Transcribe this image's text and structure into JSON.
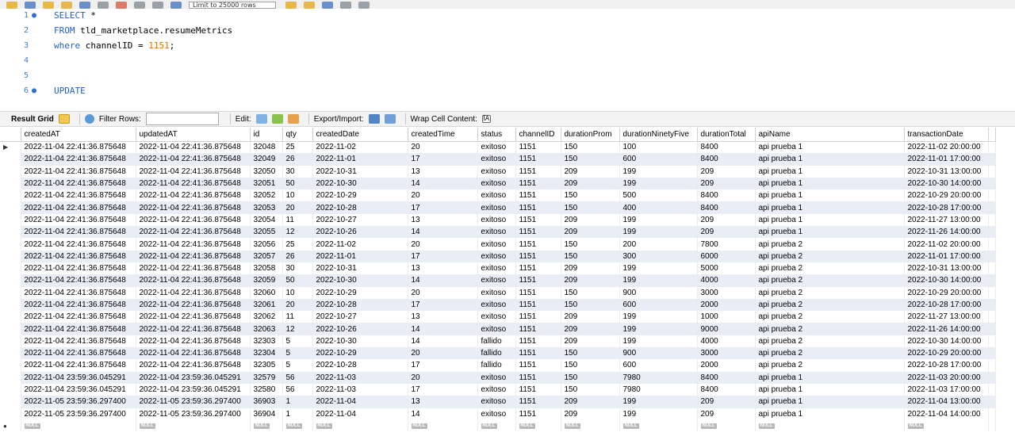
{
  "toolbar": {
    "limit_select": "Limit to 25000 rows"
  },
  "editor": {
    "lines": [
      {
        "n": "1",
        "marker": "●",
        "parts": [
          {
            "t": "SELECT",
            "c": "kw"
          },
          {
            "t": " *",
            "c": "plain"
          }
        ]
      },
      {
        "n": "2",
        "marker": "",
        "parts": [
          {
            "t": "FROM",
            "c": "kw"
          },
          {
            "t": " tld_marketplace.resumeMetrics",
            "c": "plain"
          }
        ]
      },
      {
        "n": "3",
        "marker": "",
        "parts": [
          {
            "t": "where",
            "c": "kw"
          },
          {
            "t": " channelID = ",
            "c": "plain"
          },
          {
            "t": "1151",
            "c": "num"
          },
          {
            "t": ";",
            "c": "plain"
          }
        ]
      },
      {
        "n": "4",
        "marker": "",
        "parts": []
      },
      {
        "n": "5",
        "marker": "",
        "parts": []
      },
      {
        "n": "6",
        "marker": "●",
        "parts": [
          {
            "t": "UPDATE",
            "c": "kw"
          }
        ]
      }
    ]
  },
  "result_toolbar": {
    "result_grid": "Result Grid",
    "filter_rows": "Filter Rows:",
    "edit": "Edit:",
    "export_import": "Export/Import:",
    "wrap": "Wrap Cell Content:",
    "wrap_icon": "ĪA"
  },
  "grid": {
    "columns": [
      "createdAT",
      "updatedAT",
      "id",
      "qty",
      "createdDate",
      "createdTime",
      "status",
      "channelID",
      "durationProm",
      "durationNinetyFive",
      "durationTotal",
      "apiName",
      "transactionDate"
    ],
    "null_label": "NULL",
    "current_row_marker": "▶",
    "new_row_marker": "●",
    "rows": [
      [
        "2022-11-04 22:41:36.875648",
        "2022-11-04 22:41:36.875648",
        "32048",
        "25",
        "2022-11-02",
        "20",
        "exitoso",
        "1151",
        "150",
        "100",
        "8400",
        "api prueba 1",
        "2022-11-02 20:00:00"
      ],
      [
        "2022-11-04 22:41:36.875648",
        "2022-11-04 22:41:36.875648",
        "32049",
        "26",
        "2022-11-01",
        "17",
        "exitoso",
        "1151",
        "150",
        "600",
        "8400",
        "api prueba 1",
        "2022-11-01 17:00:00"
      ],
      [
        "2022-11-04 22:41:36.875648",
        "2022-11-04 22:41:36.875648",
        "32050",
        "30",
        "2022-10-31",
        "13",
        "exitoso",
        "1151",
        "209",
        "199",
        "209",
        "api prueba 1",
        "2022-10-31 13:00:00"
      ],
      [
        "2022-11-04 22:41:36.875648",
        "2022-11-04 22:41:36.875648",
        "32051",
        "50",
        "2022-10-30",
        "14",
        "exitoso",
        "1151",
        "209",
        "199",
        "209",
        "api prueba 1",
        "2022-10-30 14:00:00"
      ],
      [
        "2022-11-04 22:41:36.875648",
        "2022-11-04 22:41:36.875648",
        "32052",
        "10",
        "2022-10-29",
        "20",
        "exitoso",
        "1151",
        "150",
        "500",
        "8400",
        "api prueba 1",
        "2022-10-29 20:00:00"
      ],
      [
        "2022-11-04 22:41:36.875648",
        "2022-11-04 22:41:36.875648",
        "32053",
        "20",
        "2022-10-28",
        "17",
        "exitoso",
        "1151",
        "150",
        "400",
        "8400",
        "api prueba 1",
        "2022-10-28 17:00:00"
      ],
      [
        "2022-11-04 22:41:36.875648",
        "2022-11-04 22:41:36.875648",
        "32054",
        "11",
        "2022-10-27",
        "13",
        "exitoso",
        "1151",
        "209",
        "199",
        "209",
        "api prueba 1",
        "2022-11-27 13:00:00"
      ],
      [
        "2022-11-04 22:41:36.875648",
        "2022-11-04 22:41:36.875648",
        "32055",
        "12",
        "2022-10-26",
        "14",
        "exitoso",
        "1151",
        "209",
        "199",
        "209",
        "api prueba 1",
        "2022-11-26 14:00:00"
      ],
      [
        "2022-11-04 22:41:36.875648",
        "2022-11-04 22:41:36.875648",
        "32056",
        "25",
        "2022-11-02",
        "20",
        "exitoso",
        "1151",
        "150",
        "200",
        "7800",
        "api prueba 2",
        "2022-11-02 20:00:00"
      ],
      [
        "2022-11-04 22:41:36.875648",
        "2022-11-04 22:41:36.875648",
        "32057",
        "26",
        "2022-11-01",
        "17",
        "exitoso",
        "1151",
        "150",
        "300",
        "6000",
        "api prueba 2",
        "2022-11-01 17:00:00"
      ],
      [
        "2022-11-04 22:41:36.875648",
        "2022-11-04 22:41:36.875648",
        "32058",
        "30",
        "2022-10-31",
        "13",
        "exitoso",
        "1151",
        "209",
        "199",
        "5000",
        "api prueba 2",
        "2022-10-31 13:00:00"
      ],
      [
        "2022-11-04 22:41:36.875648",
        "2022-11-04 22:41:36.875648",
        "32059",
        "50",
        "2022-10-30",
        "14",
        "exitoso",
        "1151",
        "209",
        "199",
        "4000",
        "api prueba 2",
        "2022-10-30 14:00:00"
      ],
      [
        "2022-11-04 22:41:36.875648",
        "2022-11-04 22:41:36.875648",
        "32060",
        "10",
        "2022-10-29",
        "20",
        "exitoso",
        "1151",
        "150",
        "900",
        "3000",
        "api prueba 2",
        "2022-10-29 20:00:00"
      ],
      [
        "2022-11-04 22:41:36.875648",
        "2022-11-04 22:41:36.875648",
        "32061",
        "20",
        "2022-10-28",
        "17",
        "exitoso",
        "1151",
        "150",
        "600",
        "2000",
        "api prueba 2",
        "2022-10-28 17:00:00"
      ],
      [
        "2022-11-04 22:41:36.875648",
        "2022-11-04 22:41:36.875648",
        "32062",
        "11",
        "2022-10-27",
        "13",
        "exitoso",
        "1151",
        "209",
        "199",
        "1000",
        "api prueba 2",
        "2022-11-27 13:00:00"
      ],
      [
        "2022-11-04 22:41:36.875648",
        "2022-11-04 22:41:36.875648",
        "32063",
        "12",
        "2022-10-26",
        "14",
        "exitoso",
        "1151",
        "209",
        "199",
        "9000",
        "api prueba 2",
        "2022-11-26 14:00:00"
      ],
      [
        "2022-11-04 22:41:36.875648",
        "2022-11-04 22:41:36.875648",
        "32303",
        "5",
        "2022-10-30",
        "14",
        "fallido",
        "1151",
        "209",
        "199",
        "4000",
        "api prueba 2",
        "2022-10-30 14:00:00"
      ],
      [
        "2022-11-04 22:41:36.875648",
        "2022-11-04 22:41:36.875648",
        "32304",
        "5",
        "2022-10-29",
        "20",
        "fallido",
        "1151",
        "150",
        "900",
        "3000",
        "api prueba 2",
        "2022-10-29 20:00:00"
      ],
      [
        "2022-11-04 22:41:36.875648",
        "2022-11-04 22:41:36.875648",
        "32305",
        "5",
        "2022-10-28",
        "17",
        "fallido",
        "1151",
        "150",
        "600",
        "2000",
        "api prueba 2",
        "2022-10-28 17:00:00"
      ],
      [
        "2022-11-04 23:59:36.045291",
        "2022-11-04 23:59:36.045291",
        "32579",
        "56",
        "2022-11-03",
        "20",
        "exitoso",
        "1151",
        "150",
        "7980",
        "8400",
        "api prueba 1",
        "2022-11-03 20:00:00"
      ],
      [
        "2022-11-04 23:59:36.045291",
        "2022-11-04 23:59:36.045291",
        "32580",
        "56",
        "2022-11-03",
        "17",
        "exitoso",
        "1151",
        "150",
        "7980",
        "8400",
        "api prueba 1",
        "2022-11-03 17:00:00"
      ],
      [
        "2022-11-05 23:59:36.297400",
        "2022-11-05 23:59:36.297400",
        "36903",
        "1",
        "2022-11-04",
        "13",
        "exitoso",
        "1151",
        "209",
        "199",
        "209",
        "api prueba 1",
        "2022-11-04 13:00:00"
      ],
      [
        "2022-11-05 23:59:36.297400",
        "2022-11-05 23:59:36.297400",
        "36904",
        "1",
        "2022-11-04",
        "14",
        "exitoso",
        "1151",
        "209",
        "199",
        "209",
        "api prueba 1",
        "2022-11-04 14:00:00"
      ]
    ]
  }
}
